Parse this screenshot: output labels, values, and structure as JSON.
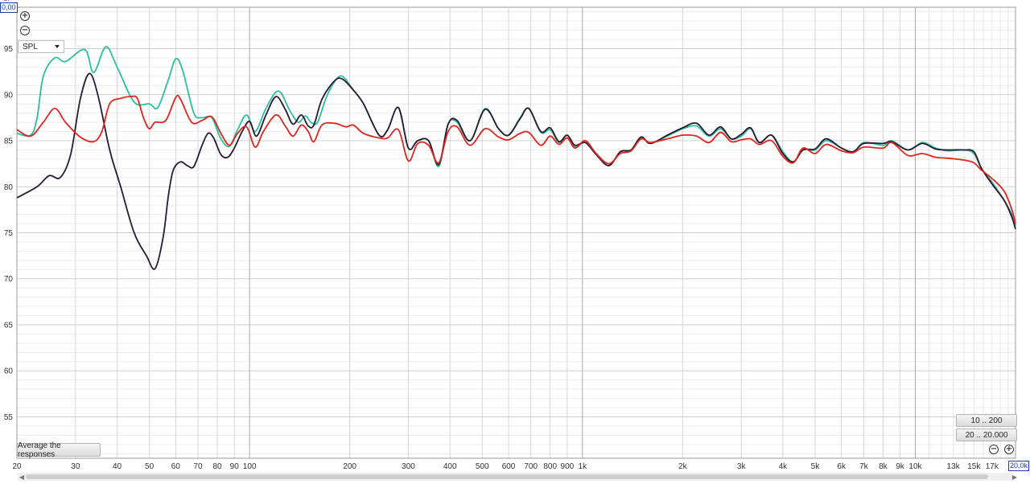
{
  "controls": {
    "zoom_in_icon": "plus-circle-icon",
    "zoom_out_icon": "minus-circle-icon",
    "measure_select": "SPL",
    "average_button": "Average the responses",
    "range_button_1": "10 .. 200",
    "range_button_2": "20 .. 20.000",
    "y_top_value": "0,00",
    "x_right_value": "20,0k",
    "y_axis_caption": "SP"
  },
  "chart_data": {
    "type": "line",
    "x_scale": "log",
    "xlim": [
      20,
      20000
    ],
    "ylim": [
      50.5,
      99.5
    ],
    "grid": true,
    "y_ticks": [
      55,
      60,
      65,
      70,
      75,
      80,
      85,
      90,
      95
    ],
    "x_ticks": [
      {
        "v": 20,
        "label": "20"
      },
      {
        "v": 30,
        "label": "30"
      },
      {
        "v": 40,
        "label": "40"
      },
      {
        "v": 50,
        "label": "50"
      },
      {
        "v": 60,
        "label": "60"
      },
      {
        "v": 70,
        "label": "70"
      },
      {
        "v": 80,
        "label": "80"
      },
      {
        "v": 90,
        "label": "90"
      },
      {
        "v": 100,
        "label": "100"
      },
      {
        "v": 200,
        "label": "200"
      },
      {
        "v": 300,
        "label": "300"
      },
      {
        "v": 400,
        "label": "400"
      },
      {
        "v": 500,
        "label": "500"
      },
      {
        "v": 600,
        "label": "600"
      },
      {
        "v": 700,
        "label": "700"
      },
      {
        "v": 800,
        "label": "800"
      },
      {
        "v": 900,
        "label": "900"
      },
      {
        "v": 1000,
        "label": "1k"
      },
      {
        "v": 2000,
        "label": "2k"
      },
      {
        "v": 3000,
        "label": "3k"
      },
      {
        "v": 4000,
        "label": "4k"
      },
      {
        "v": 5000,
        "label": "5k"
      },
      {
        "v": 6000,
        "label": "6k"
      },
      {
        "v": 7000,
        "label": "7k"
      },
      {
        "v": 8000,
        "label": "8k"
      },
      {
        "v": 9000,
        "label": "9k"
      },
      {
        "v": 10000,
        "label": "10k"
      },
      {
        "v": 13000,
        "label": "13k"
      },
      {
        "v": 15000,
        "label": "15k"
      },
      {
        "v": 17000,
        "label": "17k"
      }
    ],
    "series": [
      {
        "color": "#2bbf9e",
        "points": [
          [
            20,
            85.8
          ],
          [
            22,
            85.6
          ],
          [
            23,
            87.5
          ],
          [
            24,
            92
          ],
          [
            26,
            94
          ],
          [
            28,
            93.6
          ],
          [
            32,
            94.9
          ],
          [
            34,
            92.4
          ],
          [
            37,
            95.2
          ],
          [
            40,
            93
          ],
          [
            45,
            89.2
          ],
          [
            50,
            89
          ],
          [
            53,
            88.6
          ],
          [
            57,
            91.6
          ],
          [
            60,
            93.9
          ],
          [
            63,
            92.6
          ],
          [
            68,
            88
          ],
          [
            72,
            87.5
          ],
          [
            77,
            87.5
          ],
          [
            82,
            85.2
          ],
          [
            87,
            84.4
          ],
          [
            92,
            86.2
          ],
          [
            98,
            87.8
          ],
          [
            104,
            86
          ],
          [
            112,
            88.5
          ],
          [
            122,
            90.4
          ],
          [
            132,
            88.3
          ],
          [
            140,
            87
          ],
          [
            147,
            87.7
          ],
          [
            153,
            87
          ],
          [
            160,
            87
          ],
          [
            170,
            89.7
          ],
          [
            180,
            91.4
          ],
          [
            190,
            92
          ],
          [
            205,
            90.5
          ],
          [
            220,
            89
          ],
          [
            245,
            85.6
          ],
          [
            260,
            86.2
          ],
          [
            280,
            88.6
          ],
          [
            300,
            84.2
          ],
          [
            320,
            85
          ],
          [
            345,
            85
          ],
          [
            370,
            82.2
          ],
          [
            395,
            86.8
          ],
          [
            420,
            87
          ],
          [
            460,
            85
          ],
          [
            510,
            88.5
          ],
          [
            560,
            86.3
          ],
          [
            600,
            85.6
          ],
          [
            650,
            87.5
          ],
          [
            690,
            88.5
          ],
          [
            750,
            85.9
          ],
          [
            800,
            86.2
          ],
          [
            850,
            84.8
          ],
          [
            900,
            85.6
          ],
          [
            950,
            84.3
          ],
          [
            1020,
            84.8
          ],
          [
            1100,
            83.5
          ],
          [
            1200,
            82.3
          ],
          [
            1300,
            83.8
          ],
          [
            1400,
            84
          ],
          [
            1500,
            85.4
          ],
          [
            1600,
            84.7
          ],
          [
            1800,
            85.5
          ],
          [
            2000,
            86.3
          ],
          [
            2200,
            86.6
          ],
          [
            2400,
            85.5
          ],
          [
            2600,
            86.3
          ],
          [
            2800,
            85.2
          ],
          [
            3000,
            85.5
          ],
          [
            3200,
            86.3
          ],
          [
            3400,
            84.8
          ],
          [
            3700,
            85.6
          ],
          [
            4000,
            83.8
          ],
          [
            4300,
            82.7
          ],
          [
            4600,
            84
          ],
          [
            5000,
            84
          ],
          [
            5400,
            85
          ],
          [
            6000,
            84.2
          ],
          [
            6500,
            83.7
          ],
          [
            7000,
            84.8
          ],
          [
            8000,
            84.5
          ],
          [
            8500,
            85
          ],
          [
            9500,
            84
          ],
          [
            10500,
            84.8
          ],
          [
            11500,
            84.2
          ],
          [
            12500,
            83.9
          ],
          [
            14000,
            84
          ],
          [
            15000,
            83.6
          ],
          [
            15800,
            82
          ],
          [
            17000,
            80.5
          ],
          [
            18500,
            78.5
          ],
          [
            19500,
            77
          ],
          [
            20000,
            75.8
          ]
        ]
      },
      {
        "color": "#2a1a33",
        "points": [
          [
            20,
            78.8
          ],
          [
            23,
            80
          ],
          [
            25,
            81.2
          ],
          [
            27,
            81
          ],
          [
            29,
            83.5
          ],
          [
            31,
            89.5
          ],
          [
            33,
            92.3
          ],
          [
            35,
            90
          ],
          [
            38,
            84
          ],
          [
            41,
            80
          ],
          [
            45,
            75
          ],
          [
            49,
            72.5
          ],
          [
            52,
            71.1
          ],
          [
            55,
            74.5
          ],
          [
            57,
            79
          ],
          [
            59,
            81.8
          ],
          [
            62,
            82.7
          ],
          [
            65,
            82.3
          ],
          [
            68,
            82.2
          ],
          [
            72,
            84.5
          ],
          [
            75,
            85.8
          ],
          [
            78,
            85.3
          ],
          [
            82,
            83.5
          ],
          [
            86,
            83.2
          ],
          [
            90,
            84.2
          ],
          [
            95,
            86
          ],
          [
            100,
            87.1
          ],
          [
            105,
            85.5
          ],
          [
            112,
            87.8
          ],
          [
            120,
            89.8
          ],
          [
            128,
            88.4
          ],
          [
            135,
            86.8
          ],
          [
            143,
            87.8
          ],
          [
            150,
            86.6
          ],
          [
            156,
            86.7
          ],
          [
            165,
            89.5
          ],
          [
            180,
            91.5
          ],
          [
            190,
            91.7
          ],
          [
            205,
            90.5
          ],
          [
            220,
            89
          ],
          [
            245,
            85.6
          ],
          [
            260,
            86.2
          ],
          [
            280,
            88.6
          ],
          [
            300,
            84.2
          ],
          [
            320,
            85
          ],
          [
            345,
            85
          ],
          [
            370,
            82.4
          ],
          [
            395,
            86.8
          ],
          [
            420,
            87.2
          ],
          [
            460,
            85
          ],
          [
            510,
            88.4
          ],
          [
            560,
            86.3
          ],
          [
            600,
            85.6
          ],
          [
            650,
            87.4
          ],
          [
            690,
            88.5
          ],
          [
            750,
            86
          ],
          [
            800,
            86.4
          ],
          [
            850,
            84.9
          ],
          [
            900,
            85.6
          ],
          [
            950,
            84.5
          ],
          [
            1020,
            84.8
          ],
          [
            1100,
            83.5
          ],
          [
            1200,
            82.3
          ],
          [
            1300,
            83.8
          ],
          [
            1400,
            84
          ],
          [
            1500,
            85.4
          ],
          [
            1600,
            84.7
          ],
          [
            1800,
            85.6
          ],
          [
            2000,
            86.4
          ],
          [
            2200,
            86.9
          ],
          [
            2400,
            85.6
          ],
          [
            2600,
            86.5
          ],
          [
            2800,
            85.2
          ],
          [
            3000,
            85.7
          ],
          [
            3200,
            86.4
          ],
          [
            3400,
            84.8
          ],
          [
            3700,
            85.6
          ],
          [
            4000,
            83.6
          ],
          [
            4300,
            82.7
          ],
          [
            4600,
            84
          ],
          [
            5000,
            84.1
          ],
          [
            5400,
            85.2
          ],
          [
            6000,
            84.2
          ],
          [
            6500,
            83.8
          ],
          [
            7000,
            84.7
          ],
          [
            8000,
            84.7
          ],
          [
            8500,
            84.9
          ],
          [
            9500,
            84
          ],
          [
            10500,
            84.7
          ],
          [
            11500,
            84.1
          ],
          [
            12500,
            84
          ],
          [
            14000,
            84
          ],
          [
            15000,
            83.8
          ],
          [
            15800,
            82
          ],
          [
            17000,
            80.3
          ],
          [
            18500,
            78.5
          ],
          [
            19500,
            76.7
          ],
          [
            20000,
            75.4
          ]
        ]
      },
      {
        "color": "#e0251d",
        "points": [
          [
            20,
            86.2
          ],
          [
            22,
            85.5
          ],
          [
            24,
            87
          ],
          [
            26,
            88.5
          ],
          [
            28,
            87
          ],
          [
            31,
            85.4
          ],
          [
            34,
            84.9
          ],
          [
            36,
            86
          ],
          [
            38,
            89
          ],
          [
            41,
            89.6
          ],
          [
            44,
            89.8
          ],
          [
            46,
            89.6
          ],
          [
            48,
            87.5
          ],
          [
            50,
            86.3
          ],
          [
            52,
            87
          ],
          [
            56,
            87.2
          ],
          [
            60,
            89.7
          ],
          [
            62,
            89.5
          ],
          [
            67,
            87
          ],
          [
            72,
            87.2
          ],
          [
            77,
            87.6
          ],
          [
            82,
            85.8
          ],
          [
            87,
            84.5
          ],
          [
            92,
            85.8
          ],
          [
            98,
            86.5
          ],
          [
            104,
            84.3
          ],
          [
            110,
            86
          ],
          [
            120,
            87.8
          ],
          [
            128,
            86.6
          ],
          [
            135,
            85.5
          ],
          [
            143,
            86.7
          ],
          [
            150,
            86
          ],
          [
            156,
            84.9
          ],
          [
            165,
            86.7
          ],
          [
            180,
            86.9
          ],
          [
            195,
            86.5
          ],
          [
            205,
            86.7
          ],
          [
            220,
            85.8
          ],
          [
            245,
            85.3
          ],
          [
            260,
            85.3
          ],
          [
            280,
            86.2
          ],
          [
            300,
            82.8
          ],
          [
            320,
            84.7
          ],
          [
            345,
            84.5
          ],
          [
            370,
            82.6
          ],
          [
            395,
            86
          ],
          [
            420,
            86.5
          ],
          [
            460,
            84.5
          ],
          [
            510,
            86.3
          ],
          [
            560,
            85.4
          ],
          [
            600,
            85.1
          ],
          [
            650,
            85.8
          ],
          [
            690,
            85.9
          ],
          [
            750,
            84.5
          ],
          [
            800,
            85.5
          ],
          [
            850,
            84.6
          ],
          [
            900,
            85.3
          ],
          [
            950,
            84.2
          ],
          [
            1020,
            85
          ],
          [
            1100,
            83.6
          ],
          [
            1200,
            82.5
          ],
          [
            1300,
            83.6
          ],
          [
            1400,
            83.9
          ],
          [
            1500,
            85.2
          ],
          [
            1600,
            84.8
          ],
          [
            1800,
            85.2
          ],
          [
            2000,
            85.6
          ],
          [
            2200,
            85.5
          ],
          [
            2400,
            84.8
          ],
          [
            2600,
            85.9
          ],
          [
            2800,
            84.9
          ],
          [
            3000,
            85.1
          ],
          [
            3200,
            85.2
          ],
          [
            3400,
            84.6
          ],
          [
            3700,
            85
          ],
          [
            4000,
            83.3
          ],
          [
            4300,
            82.6
          ],
          [
            4600,
            84.2
          ],
          [
            5000,
            83.6
          ],
          [
            5400,
            84.6
          ],
          [
            6000,
            83.9
          ],
          [
            6500,
            83.7
          ],
          [
            7000,
            84.3
          ],
          [
            8000,
            84.2
          ],
          [
            8500,
            84.8
          ],
          [
            9500,
            83.4
          ],
          [
            10500,
            83.6
          ],
          [
            11500,
            83.2
          ],
          [
            12500,
            83.1
          ],
          [
            14000,
            82.9
          ],
          [
            15000,
            82.6
          ],
          [
            15800,
            81.8
          ],
          [
            17000,
            80.9
          ],
          [
            18500,
            79.5
          ],
          [
            19500,
            77.5
          ],
          [
            20000,
            76
          ]
        ]
      }
    ]
  }
}
